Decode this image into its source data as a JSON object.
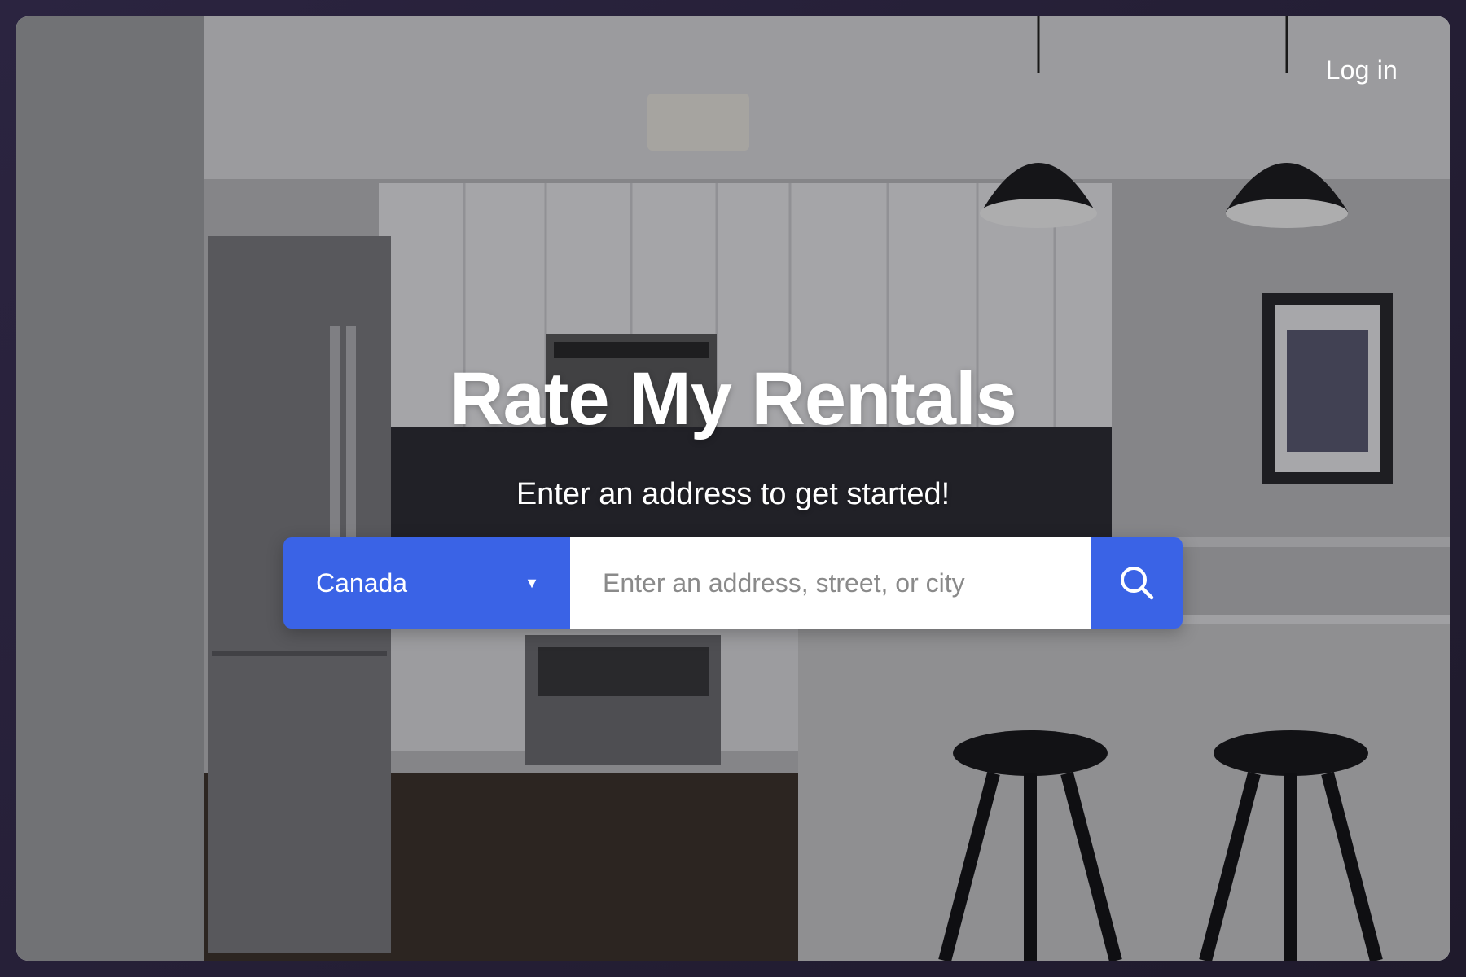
{
  "header": {
    "login_label": "Log in"
  },
  "hero": {
    "title": "Rate My Rentals",
    "subtitle": "Enter an address to get started!"
  },
  "search": {
    "country_selected": "Canada",
    "placeholder": "Enter an address, street, or city",
    "value": ""
  },
  "icons": {
    "caret": "chevron-down-icon",
    "search": "search-icon"
  },
  "colors": {
    "accent": "#3a63e6",
    "text_on_dark": "#ffffff",
    "placeholder": "#8a8a8a"
  }
}
